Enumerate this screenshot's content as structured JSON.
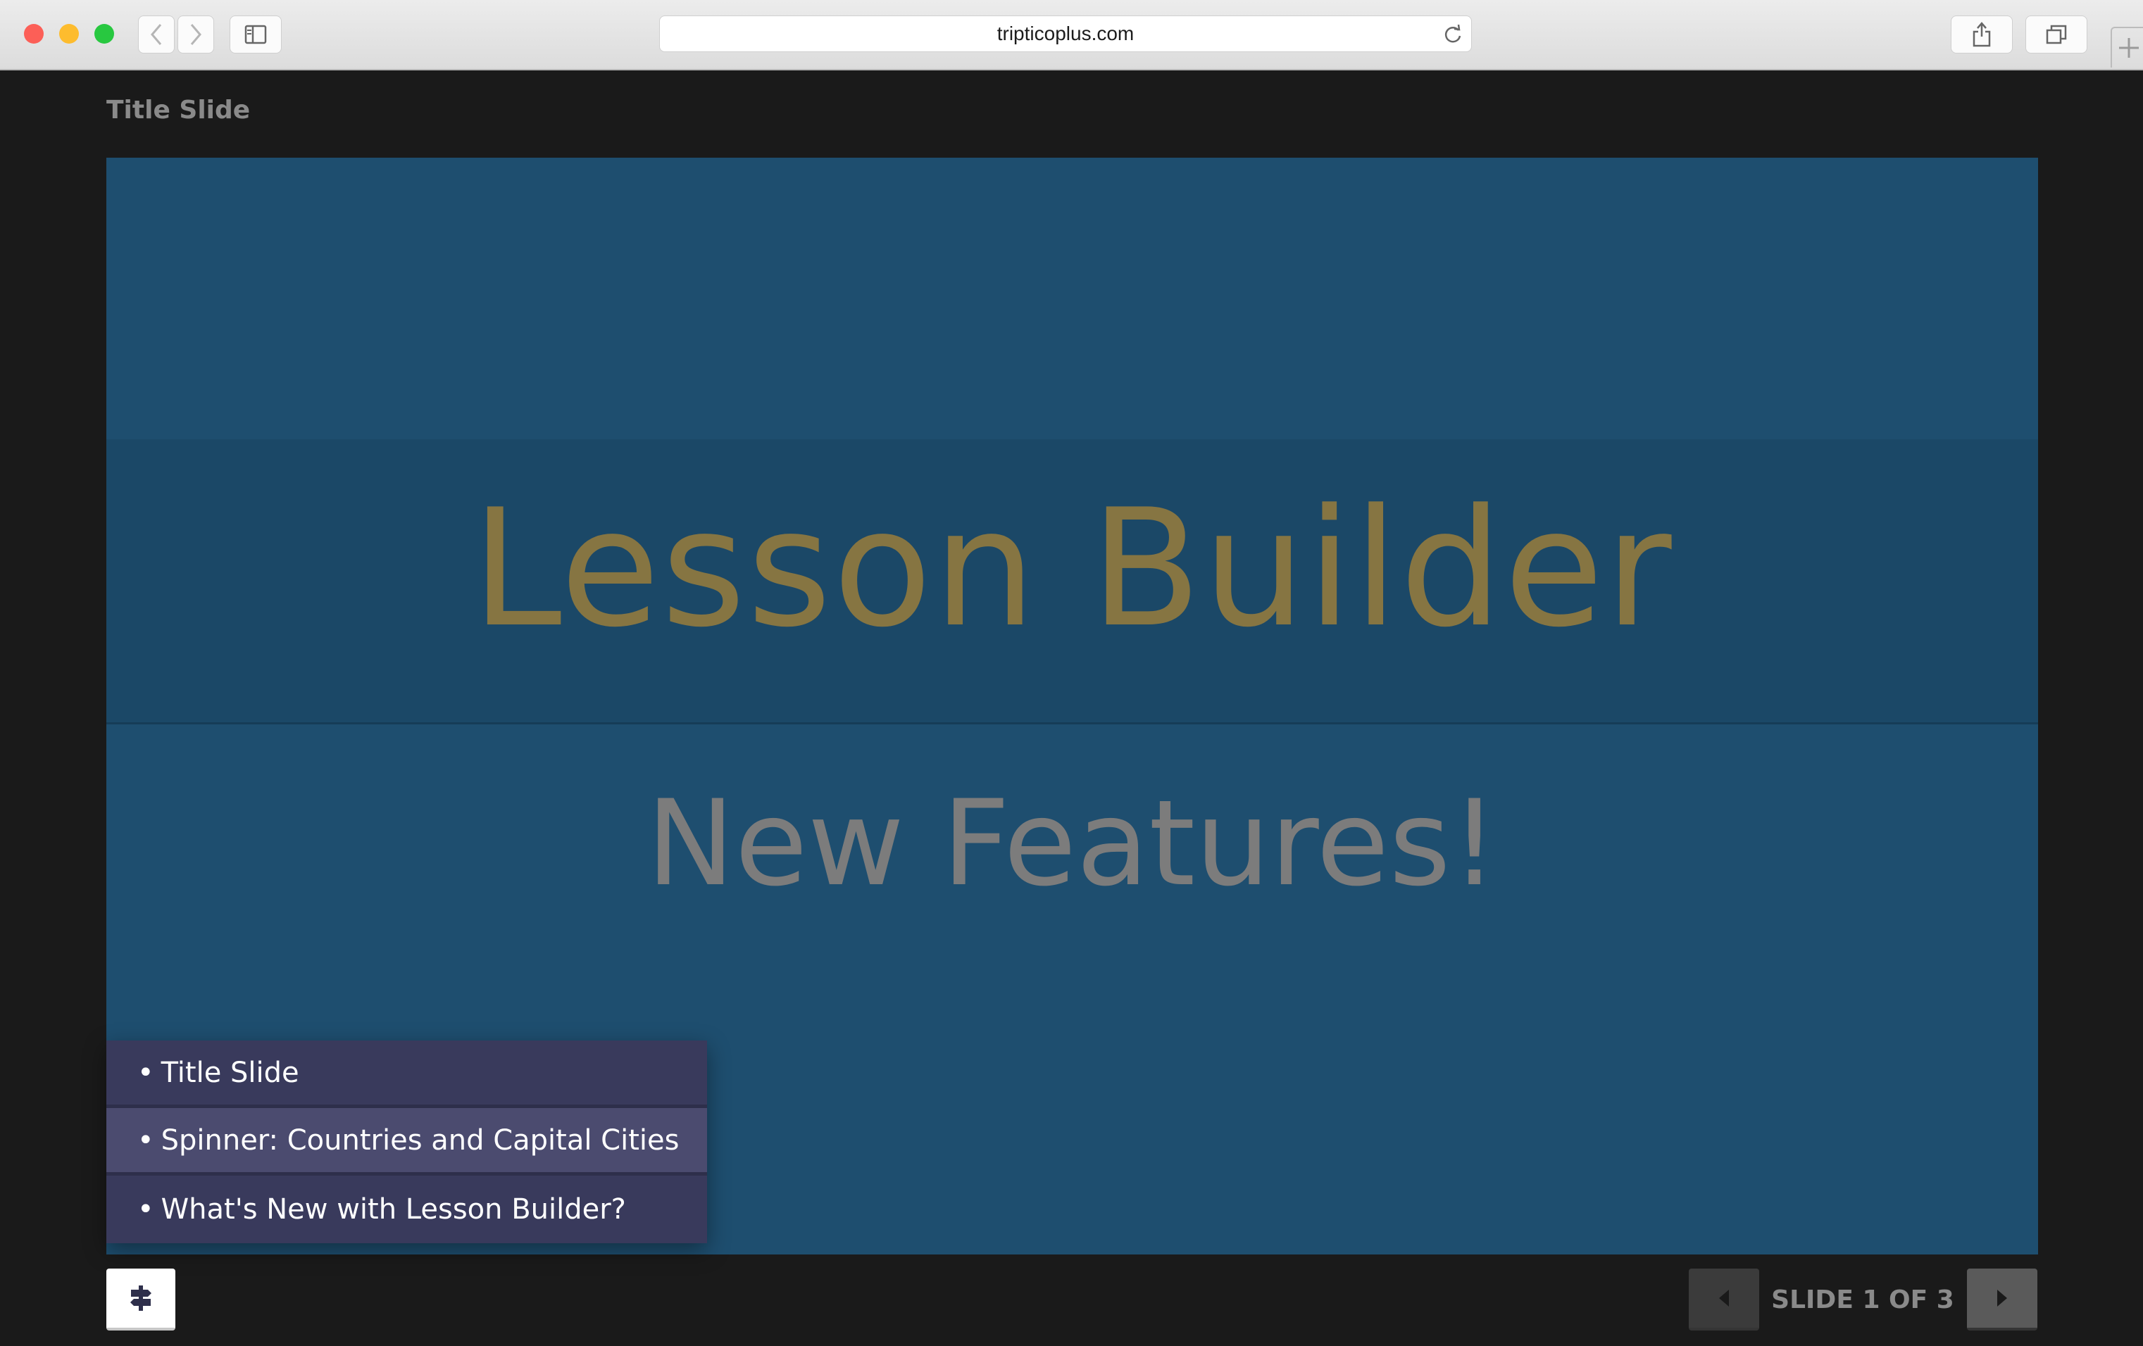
{
  "browser": {
    "url": "tripticoplus.com",
    "icons": {
      "back": "chevron-left-icon",
      "forward": "chevron-right-icon",
      "sidebar": "sidebar-icon",
      "reload": "reload-icon",
      "share": "share-icon",
      "tabs": "tabs-icon"
    }
  },
  "page": {
    "current_slide_label": "Title Slide"
  },
  "slide": {
    "heading": "Lesson Builder",
    "subheading": "New Features!",
    "colors": {
      "background": "#1e4e6f",
      "heading": "#867542",
      "subheading": "#7c7c7c"
    }
  },
  "slide_menu": {
    "bullet": "•",
    "items": [
      {
        "label": "Title Slide"
      },
      {
        "label": "Spinner: Countries and Capital Cities"
      },
      {
        "label": "What's New with Lesson Builder?"
      }
    ]
  },
  "footer": {
    "counter": "SLIDE 1 OF 3",
    "menu_toggle_icon": "signpost-icon",
    "prev_icon": "triangle-left-icon",
    "next_icon": "triangle-right-icon"
  }
}
